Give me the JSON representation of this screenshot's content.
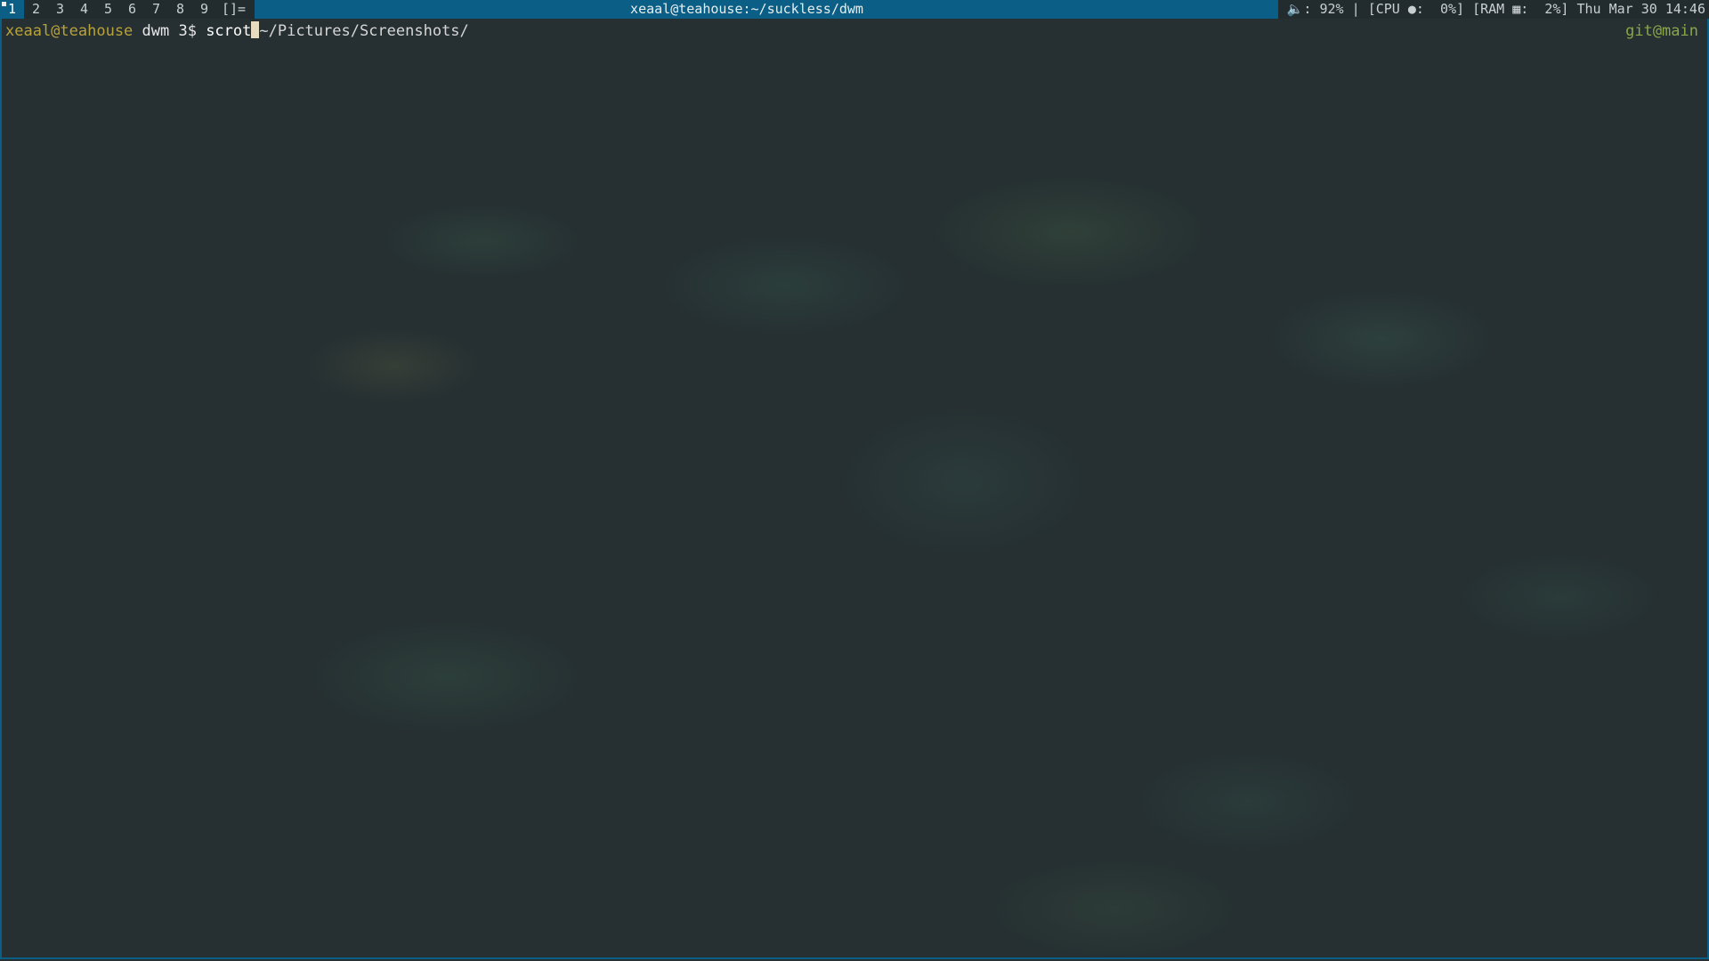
{
  "bar": {
    "tags": [
      "1",
      "2",
      "3",
      "4",
      "5",
      "6",
      "7",
      "8",
      "9"
    ],
    "selected_tag": "1",
    "layout_symbol": "[]=",
    "window_title": "xeaal@teahouse:~/suckless/dwm",
    "status": {
      "volume_icon": "speaker-icon",
      "volume_text": "🔈: 92%",
      "sep": " | ",
      "cpu_text": "[CPU ●:  0%]",
      "ram_text": " [RAM ▦:  2%]",
      "datetime": " Thu Mar 30 14:46"
    }
  },
  "terminal": {
    "prompt_user": "xeaal@teahouse",
    "prompt_dir": " dwm 3$ ",
    "command": "scrot",
    "argument": "~/Pictures/Screenshots/",
    "git_status": "git@main"
  },
  "colors": {
    "bar_accent": "#0b5e86",
    "background": "#263032",
    "prompt_user": "#b8a23a",
    "git": "#8aa64a"
  }
}
